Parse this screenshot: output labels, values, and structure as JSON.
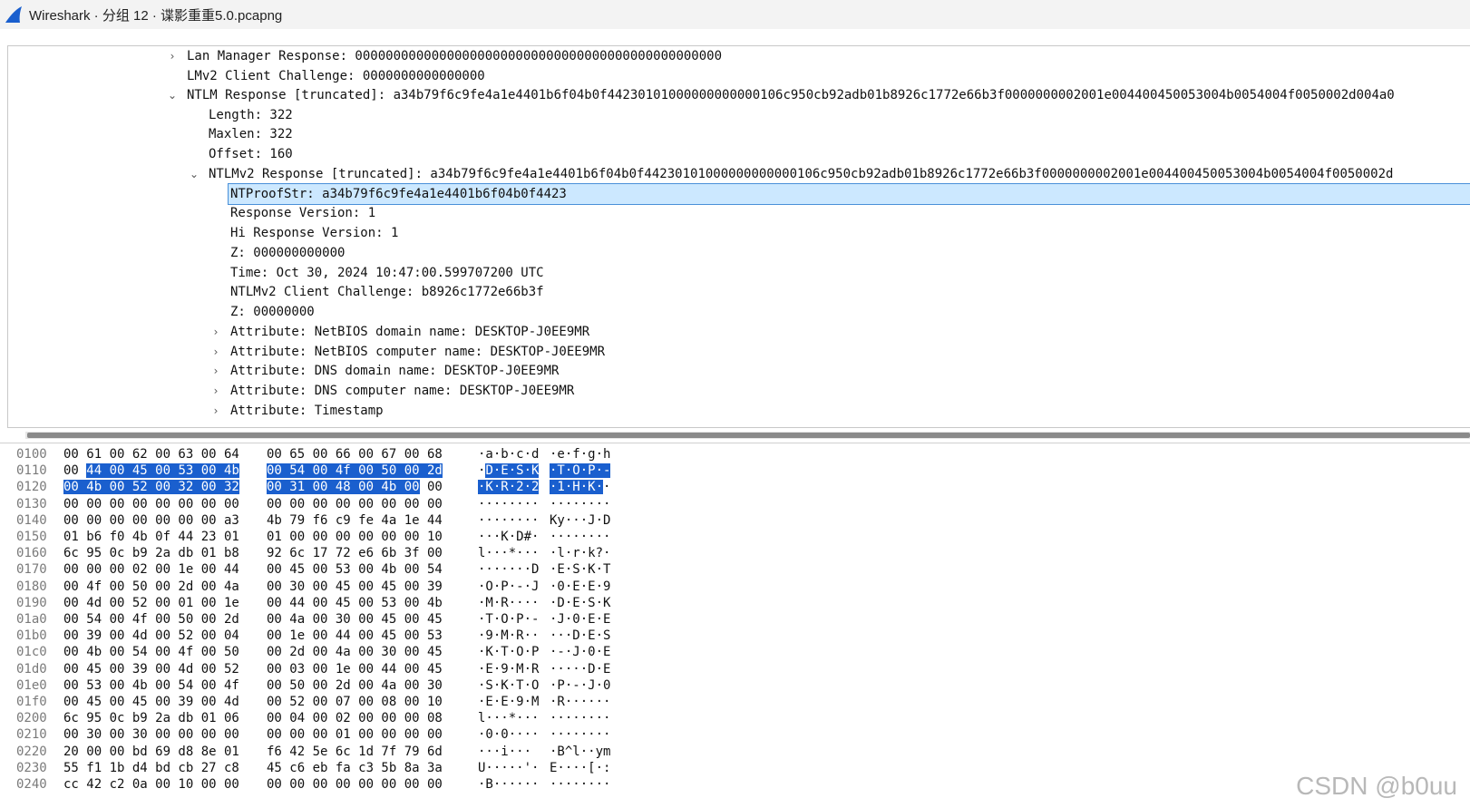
{
  "window": {
    "title": "Wireshark · 分组 12 · 谍影重重5.0.pcapng",
    "logo_icon": "wireshark-fin-icon",
    "accent": "#1a5fce"
  },
  "tree": {
    "rows": [
      {
        "text": "Lan Manager Response: 000000000000000000000000000000000000000000000000",
        "expander": "collapsed",
        "selected": false
      },
      {
        "text": "LMv2 Client Challenge: 0000000000000000",
        "expander": "none",
        "selected": false
      },
      {
        "text": "NTLM Response [truncated]: a34b79f6c9fe4a1e4401b6f04b0f44230101000000000000106c950cb92adb01b8926c1772e66b3f0000000002001e004400450053004b0054004f0050002d004a0",
        "expander": "expanded",
        "selected": false
      },
      {
        "text": "Length: 322",
        "expander": "none",
        "selected": false
      },
      {
        "text": "Maxlen: 322",
        "expander": "none",
        "selected": false
      },
      {
        "text": "Offset: 160",
        "expander": "none",
        "selected": false
      },
      {
        "text": "NTLMv2 Response [truncated]: a34b79f6c9fe4a1e4401b6f04b0f44230101000000000000106c950cb92adb01b8926c1772e66b3f0000000002001e004400450053004b0054004f0050002d",
        "expander": "expanded",
        "selected": false
      },
      {
        "text": "NTProofStr: a34b79f6c9fe4a1e4401b6f04b0f4423",
        "expander": "none",
        "selected": true
      },
      {
        "text": "Response Version: 1",
        "expander": "none",
        "selected": false
      },
      {
        "text": "Hi Response Version: 1",
        "expander": "none",
        "selected": false
      },
      {
        "text": "Z: 000000000000",
        "expander": "none",
        "selected": false
      },
      {
        "text": "Time: Oct 30, 2024 10:47:00.599707200 UTC",
        "expander": "none",
        "selected": false
      },
      {
        "text": "NTLMv2 Client Challenge: b8926c1772e66b3f",
        "expander": "none",
        "selected": false
      },
      {
        "text": "Z: 00000000",
        "expander": "none",
        "selected": false
      },
      {
        "text": "Attribute: NetBIOS domain name: DESKTOP-J0EE9MR",
        "expander": "collapsed",
        "selected": false
      },
      {
        "text": "Attribute: NetBIOS computer name: DESKTOP-J0EE9MR",
        "expander": "collapsed",
        "selected": false
      },
      {
        "text": "Attribute: DNS domain name: DESKTOP-J0EE9MR",
        "expander": "collapsed",
        "selected": false
      },
      {
        "text": "Attribute: DNS computer name: DESKTOP-J0EE9MR",
        "expander": "collapsed",
        "selected": false
      },
      {
        "text": "Attribute: Timestamp",
        "expander": "collapsed",
        "selected": false
      }
    ]
  },
  "hex": {
    "rows": [
      {
        "offset": "0100",
        "bytes1": "00 61 00 62 00 63 00 64",
        "bytes2": "00 65 00 66 00 67 00 68",
        "ascii1": "·a·b·c·d",
        "ascii2": "·e·f·g·h"
      },
      {
        "offset": "0110",
        "bytes1": "00 44 00 45 00 53 00 4b",
        "bytes2": "00 54 00 4f 00 50 00 2d",
        "ascii1": "·D·E·S·K",
        "ascii2": "·T·O·P·-"
      },
      {
        "offset": "0120",
        "bytes1": "00 4b 00 52 00 32 00 32",
        "bytes2": "00 31 00 48 00 4b 00 00",
        "ascii1": "·K·R·2·2",
        "ascii2": "·1·H·K··"
      },
      {
        "offset": "0130",
        "bytes1": "00 00 00 00 00 00 00 00",
        "bytes2": "00 00 00 00 00 00 00 00",
        "ascii1": "········",
        "ascii2": "········"
      },
      {
        "offset": "0140",
        "bytes1": "00 00 00 00 00 00 00 a3",
        "bytes2": "4b 79 f6 c9 fe 4a 1e 44",
        "ascii1": "········",
        "ascii2": "Ky···J·D"
      },
      {
        "offset": "0150",
        "bytes1": "01 b6 f0 4b 0f 44 23 01",
        "bytes2": "01 00 00 00 00 00 00 10",
        "ascii1": "···K·D#·",
        "ascii2": "········"
      },
      {
        "offset": "0160",
        "bytes1": "6c 95 0c b9 2a db 01 b8",
        "bytes2": "92 6c 17 72 e6 6b 3f 00",
        "ascii1": "l···*···",
        "ascii2": "·l·r·k?·"
      },
      {
        "offset": "0170",
        "bytes1": "00 00 00 02 00 1e 00 44",
        "bytes2": "00 45 00 53 00 4b 00 54",
        "ascii1": "·······D",
        "ascii2": "·E·S·K·T"
      },
      {
        "offset": "0180",
        "bytes1": "00 4f 00 50 00 2d 00 4a",
        "bytes2": "00 30 00 45 00 45 00 39",
        "ascii1": "·O·P·-·J",
        "ascii2": "·0·E·E·9"
      },
      {
        "offset": "0190",
        "bytes1": "00 4d 00 52 00 01 00 1e",
        "bytes2": "00 44 00 45 00 53 00 4b",
        "ascii1": "·M·R····",
        "ascii2": "·D·E·S·K"
      },
      {
        "offset": "01a0",
        "bytes1": "00 54 00 4f 00 50 00 2d",
        "bytes2": "00 4a 00 30 00 45 00 45",
        "ascii1": "·T·O·P·-",
        "ascii2": "·J·0·E·E"
      },
      {
        "offset": "01b0",
        "bytes1": "00 39 00 4d 00 52 00 04",
        "bytes2": "00 1e 00 44 00 45 00 53",
        "ascii1": "·9·M·R··",
        "ascii2": "···D·E·S"
      },
      {
        "offset": "01c0",
        "bytes1": "00 4b 00 54 00 4f 00 50",
        "bytes2": "00 2d 00 4a 00 30 00 45",
        "ascii1": "·K·T·O·P",
        "ascii2": "·-·J·0·E"
      },
      {
        "offset": "01d0",
        "bytes1": "00 45 00 39 00 4d 00 52",
        "bytes2": "00 03 00 1e 00 44 00 45",
        "ascii1": "·E·9·M·R",
        "ascii2": "·····D·E"
      },
      {
        "offset": "01e0",
        "bytes1": "00 53 00 4b 00 54 00 4f",
        "bytes2": "00 50 00 2d 00 4a 00 30",
        "ascii1": "·S·K·T·O",
        "ascii2": "·P·-·J·0"
      },
      {
        "offset": "01f0",
        "bytes1": "00 45 00 45 00 39 00 4d",
        "bytes2": "00 52 00 07 00 08 00 10",
        "ascii1": "·E·E·9·M",
        "ascii2": "·R······"
      },
      {
        "offset": "0200",
        "bytes1": "6c 95 0c b9 2a db 01 06",
        "bytes2": "00 04 00 02 00 00 00 08",
        "ascii1": "l···*···",
        "ascii2": "········"
      },
      {
        "offset": "0210",
        "bytes1": "00 30 00 30 00 00 00 00",
        "bytes2": "00 00 00 01 00 00 00 00",
        "ascii1": "·0·0····",
        "ascii2": "········"
      },
      {
        "offset": "0220",
        "bytes1": "20 00 00 bd 69 d8 8e 01",
        "bytes2": "f6 42 5e 6c 1d 7f 79 6d",
        "ascii1": " ···i···",
        "ascii2": "·B^l··ym"
      },
      {
        "offset": "0230",
        "bytes1": "55 f1 1b d4 bd cb 27 c8",
        "bytes2": "45 c6 eb fa c3 5b 8a 3a",
        "ascii1": "U·····'·",
        "ascii2": "E····[·:"
      },
      {
        "offset": "0240",
        "bytes1": "cc 42 c2 0a 00 10 00 00",
        "bytes2": "00 00 00 00 00 00 00 00",
        "ascii1": "·B······",
        "ascii2": "········"
      }
    ]
  },
  "watermark": "CSDN @b0uu"
}
